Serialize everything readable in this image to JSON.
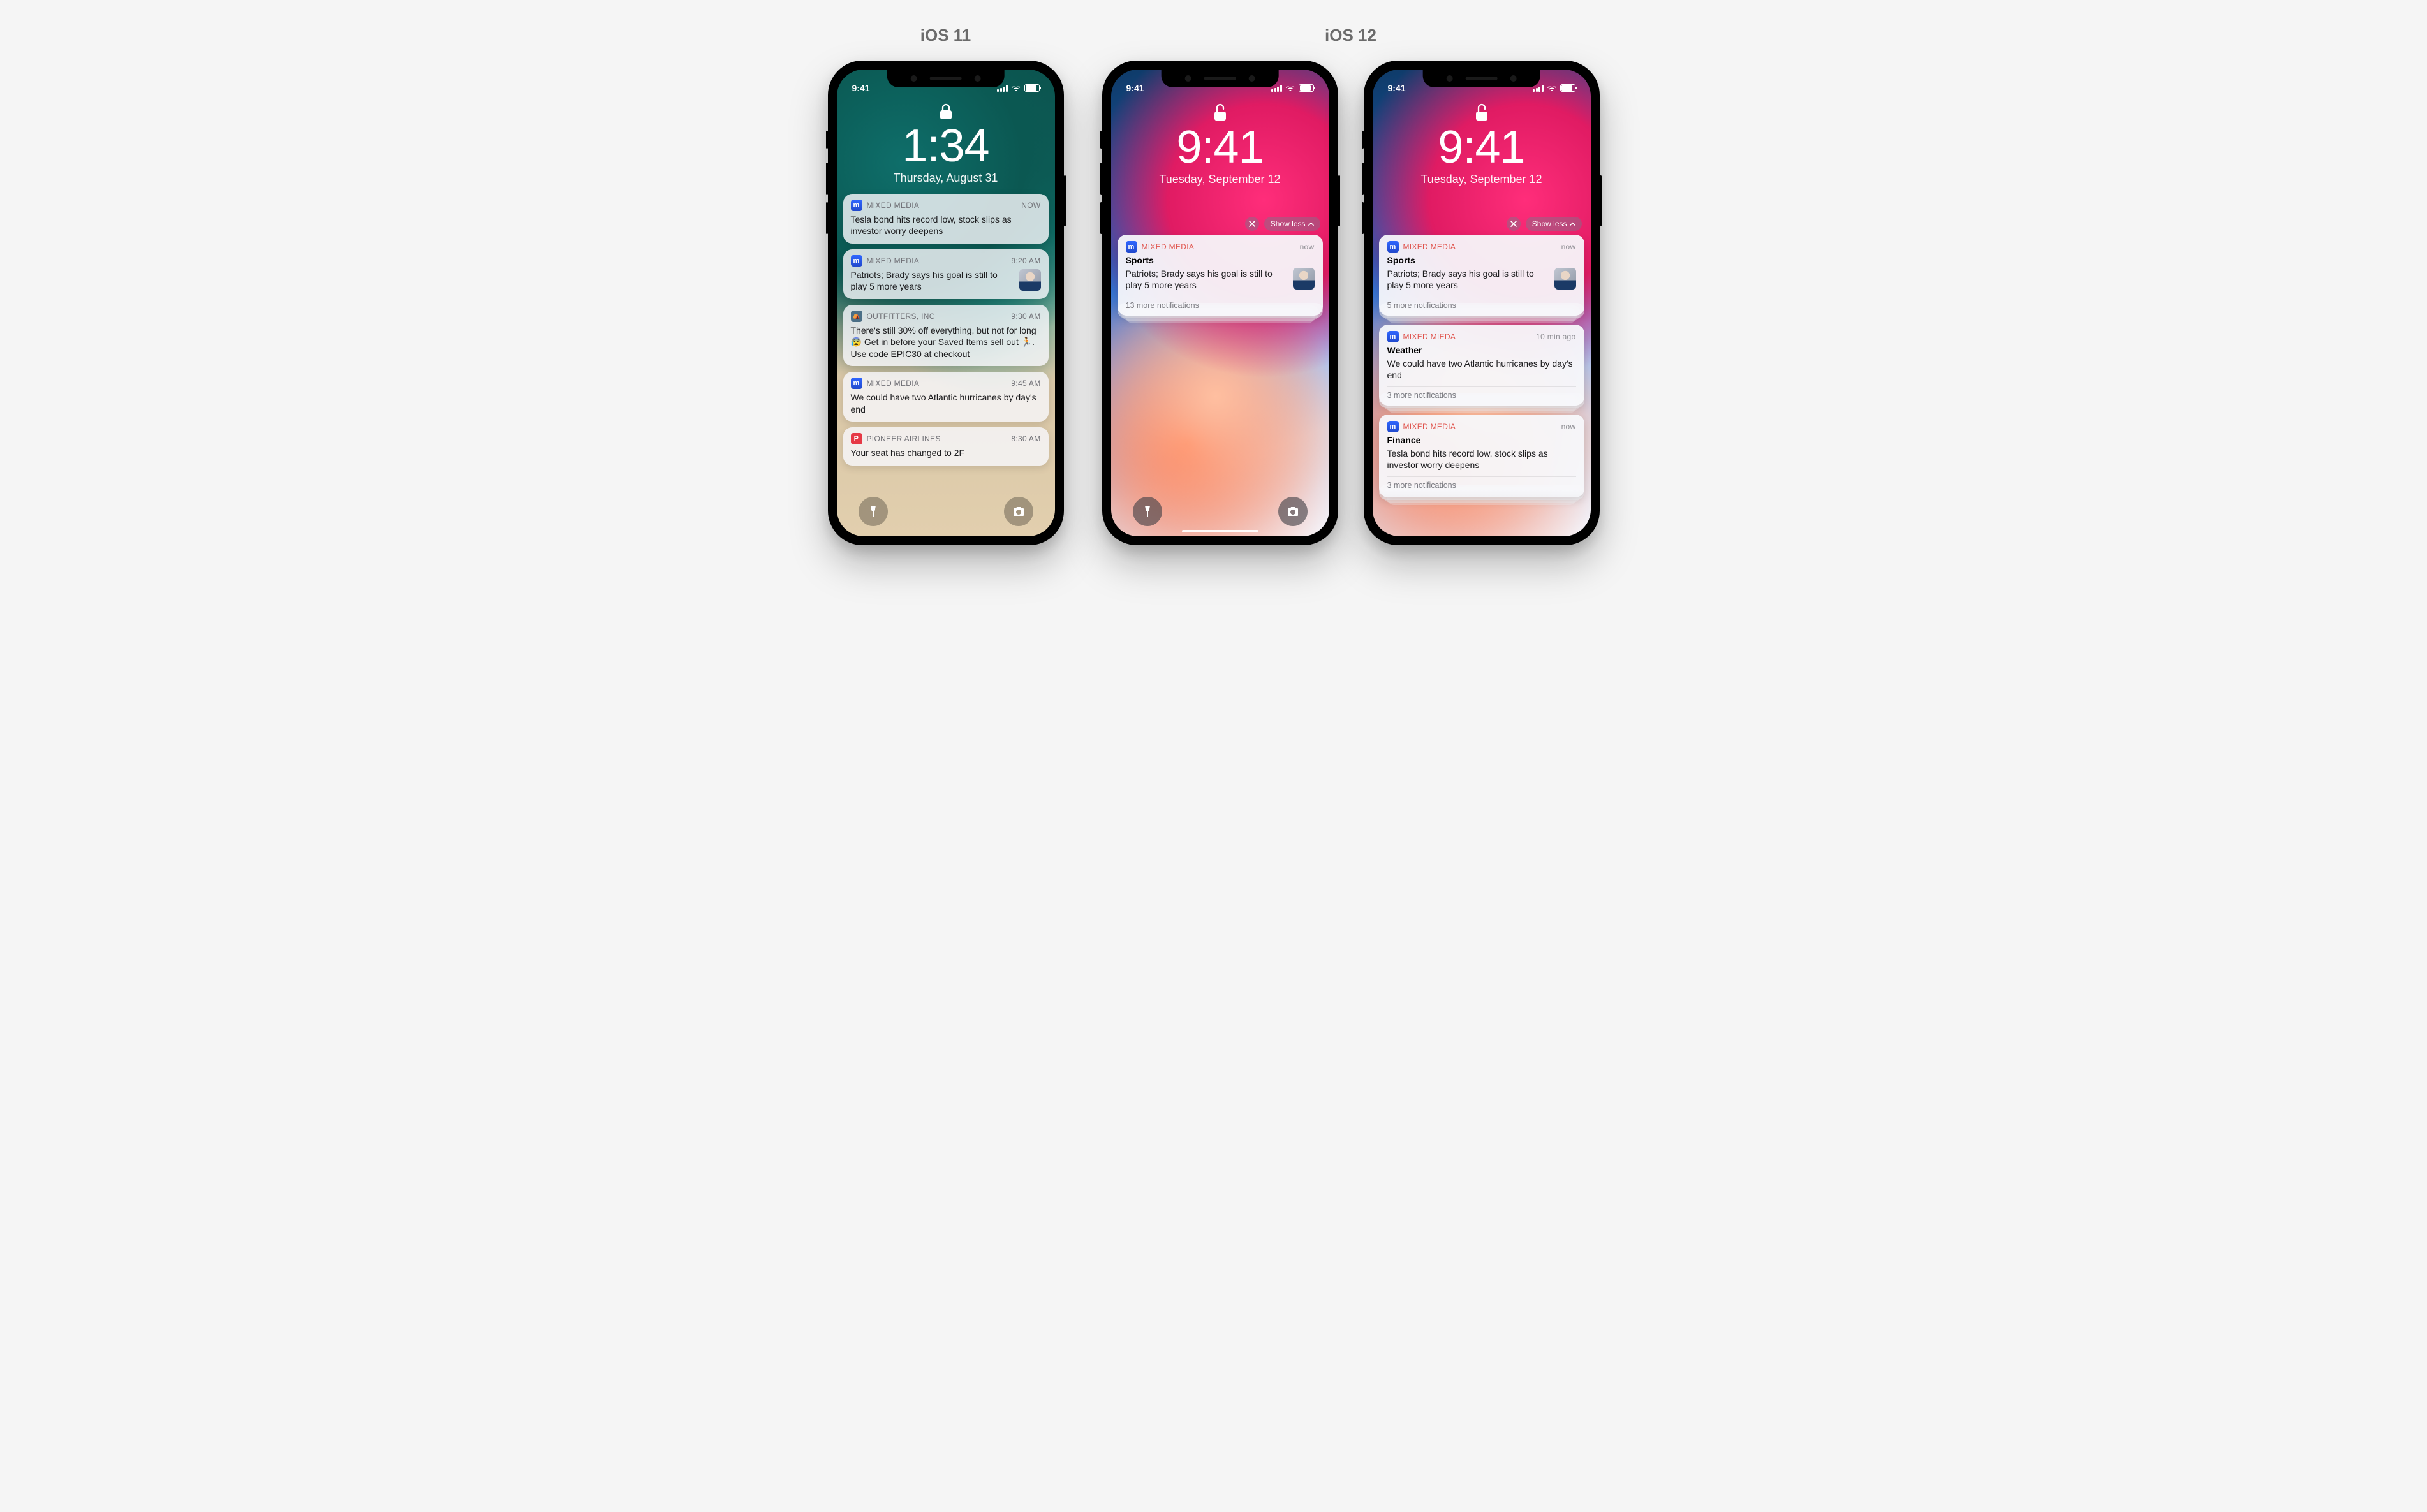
{
  "labels": {
    "ios11": "iOS 11",
    "ios12": "iOS 12"
  },
  "phone1": {
    "status_time": "9:41",
    "time": "1:34",
    "date": "Thursday, August 31",
    "notifications": [
      {
        "app": "MIXED MEDIA",
        "icon": "m",
        "time": "NOW",
        "body": "Tesla bond hits record low, stock slips as investor worry deepens",
        "thumb": false
      },
      {
        "app": "MIXED MEDIA",
        "icon": "m",
        "time": "9:20 AM",
        "body": "Patriots; Brady says his goal is still to play 5 more years",
        "thumb": true
      },
      {
        "app": "OUTFITTERS, INC",
        "icon": "o",
        "time": "9:30 AM",
        "body": "There's still 30% off everything, but not for long 😰 Get in before your Saved Items sell out 🏃. Use code EPIC30 at checkout",
        "thumb": false
      },
      {
        "app": "MIXED MEDIA",
        "icon": "m",
        "time": "9:45 AM",
        "body": "We could have two Atlantic hurricanes by day's end",
        "thumb": false
      },
      {
        "app": "PIONEER AIRLINES",
        "icon": "p",
        "time": "8:30 AM",
        "body": "Your seat has changed to 2F",
        "thumb": false
      }
    ]
  },
  "phone2": {
    "status_time": "9:41",
    "time": "9:41",
    "date": "Tuesday, September 12",
    "show_less_label": "Show less",
    "stack": {
      "app": "MIXED MEDIA",
      "time": "now",
      "title": "Sports",
      "body": "Patriots; Brady says his goal is still to play 5 more years",
      "more": "13 more notifications",
      "thumb": true
    }
  },
  "phone3": {
    "status_time": "9:41",
    "time": "9:41",
    "date": "Tuesday, September 12",
    "show_less_label": "Show less",
    "stacks": [
      {
        "app": "MIXED MEDIA",
        "time": "now",
        "title": "Sports",
        "body": "Patriots; Brady says his goal is still to play 5 more years",
        "more": "5 more notifications",
        "thumb": true
      },
      {
        "app": "MIXED MIEDA",
        "time": "10 min ago",
        "title": "Weather",
        "body": "We could have two Atlantic hurricanes by day's end",
        "more": "3 more notifications",
        "thumb": false
      },
      {
        "app": "MIXED MEDIA",
        "time": "now",
        "title": "Finance",
        "body": "Tesla bond hits record low, stock slips as investor worry deepens",
        "more": "3 more notifications",
        "thumb": false
      }
    ]
  }
}
